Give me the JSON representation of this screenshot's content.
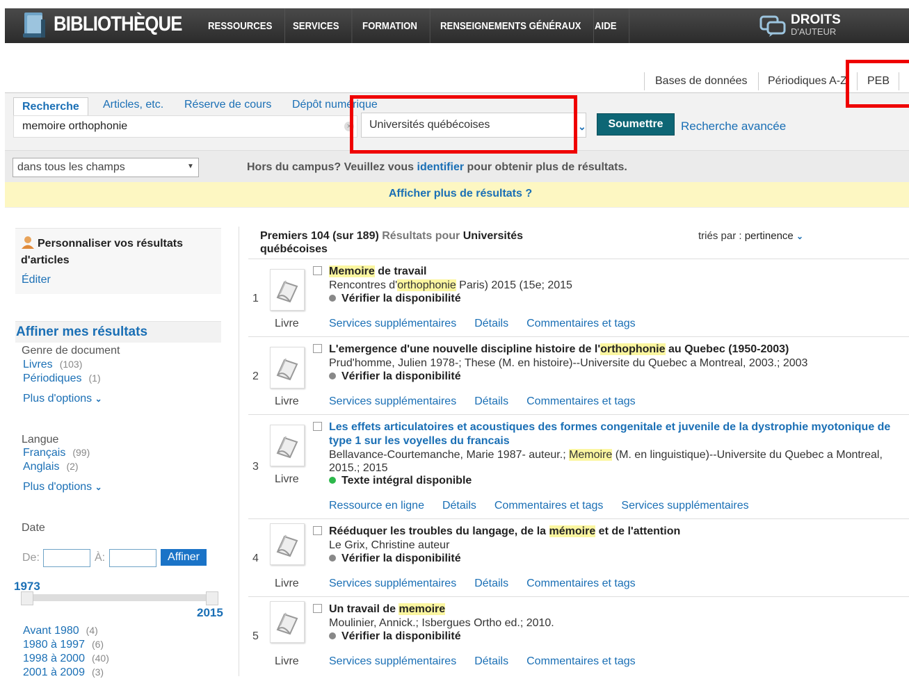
{
  "header": {
    "logo": "BIBLIOTHÈQUE",
    "nav": [
      "RESSOURCES",
      "SERVICES",
      "FORMATION",
      "RENSEIGNEMENTS GÉNÉRAUX",
      "AIDE"
    ],
    "droits_line1": "DROITS",
    "droits_line2": "D'AUTEUR"
  },
  "util_links": [
    "Bases de données",
    "Périodiques A-Z",
    "PEB"
  ],
  "search": {
    "tabs": [
      "Recherche",
      "Articles, etc.",
      "Réserve de cours",
      "Dépôt numérique"
    ],
    "active_tab": "Recherche",
    "query": "memoire orthophonie",
    "scope": "Universités québécoises",
    "submit_label": "Soumettre",
    "advanced_label": "Recherche avancée",
    "field_select": "dans tous les champs",
    "offcampus_pre": "Hors du campus? Veuillez vous",
    "offcampus_link": "identifier",
    "offcampus_post": "pour obtenir plus de résultats.",
    "more_results": "Afficher plus de résultats ?"
  },
  "sidebar": {
    "personalize_title": "Personnaliser vos résultats d'articles",
    "edit_label": "Éditer",
    "refine_title": "Affiner mes résultats",
    "genre_title": "Genre de document",
    "genre_items": [
      {
        "label": "Livres",
        "count": "(103)"
      },
      {
        "label": "Périodiques",
        "count": "(1)"
      }
    ],
    "more_options": "Plus d'options",
    "langue_title": "Langue",
    "langue_items": [
      {
        "label": "Français",
        "count": "(99)"
      },
      {
        "label": "Anglais",
        "count": "(2)"
      }
    ],
    "date_title": "Date",
    "from_label": "De:",
    "to_label": "À:",
    "refine_btn": "Affiner",
    "range_min": "1973",
    "range_max": "2015",
    "date_items": [
      {
        "label": "Avant 1980",
        "count": "(4)"
      },
      {
        "label": "1980 à 1997",
        "count": "(6)"
      },
      {
        "label": "1998 à 2000",
        "count": "(40)"
      },
      {
        "label": "2001 à 2009",
        "count": "(3)"
      }
    ]
  },
  "results_header": {
    "prefix": "Premiers 104 (sur",
    "total": "189)",
    "results_word": "Résultats",
    "pour": "pour",
    "scope_line1": "Universités",
    "scope_line2": "québécoises",
    "sort_label": "triés par :",
    "sort_value": "pertinence"
  },
  "results": [
    {
      "num": "1",
      "type": "Livre",
      "title_parts": [
        [
          "Memoire",
          true
        ],
        [
          " de travail",
          false
        ]
      ],
      "meta_parts": [
        [
          "Rencontres d'",
          false
        ],
        [
          "orthophonie",
          true
        ],
        [
          " Paris) 2015 (15e; 2015",
          false
        ]
      ],
      "availability": "Vérifier la disponibilité",
      "avail_color": "#888888",
      "links": [
        "Services supplémentaires",
        "Détails",
        "Commentaires et tags"
      ]
    },
    {
      "num": "2",
      "type": "Livre",
      "title_parts": [
        [
          "L'emergence d'une nouvelle discipline histoire de l'",
          false
        ],
        [
          "orthophonie",
          true
        ],
        [
          " au Quebec (1950-2003)",
          false
        ]
      ],
      "meta_parts": [
        [
          "Prud'homme, Julien 1978-; These (M. en histoire)--Universite du Quebec a Montreal, 2003.; 2003",
          false
        ]
      ],
      "availability": "Vérifier la disponibilité",
      "avail_color": "#888888",
      "links": [
        "Services supplémentaires",
        "Détails",
        "Commentaires et tags"
      ]
    },
    {
      "num": "3",
      "type": "Livre",
      "title_parts": [
        [
          "Les effets articulatoires et acoustiques des formes congenitale et juvenile de la dystrophie myotonique de type 1 sur les voyelles du francais",
          false
        ]
      ],
      "meta_parts": [
        [
          "Bellavance-Courtemanche, Marie 1987- auteur.; ",
          false
        ],
        [
          "Memoire",
          true
        ],
        [
          " (M. en linguistique)--Universite du Quebec a Montreal, 2015.; 2015",
          false
        ]
      ],
      "availability": "Texte intégral disponible",
      "avail_color": "#2db84b",
      "links": [
        "Ressource en ligne",
        "Détails",
        "Commentaires et tags",
        "Services supplémentaires"
      ]
    },
    {
      "num": "4",
      "type": "Livre",
      "title_parts": [
        [
          "Rééduquer les troubles du langage, de la ",
          false
        ],
        [
          "mémoire",
          true
        ],
        [
          " et de l'attention",
          false
        ]
      ],
      "meta_parts": [
        [
          "Le Grix, Christine auteur",
          false
        ]
      ],
      "availability": "Vérifier la disponibilité",
      "avail_color": "#888888",
      "links": [
        "Services supplémentaires",
        "Détails",
        "Commentaires et tags"
      ]
    },
    {
      "num": "5",
      "type": "Livre",
      "title_parts": [
        [
          "Un travail de ",
          false
        ],
        [
          "memoire",
          true
        ]
      ],
      "meta_parts": [
        [
          "Moulinier, Annick.; Isbergues Ortho ed.; 2010.",
          false
        ]
      ],
      "availability": "Vérifier la disponibilité",
      "avail_color": "#888888",
      "links": [
        "Services supplémentaires",
        "Détails",
        "Commentaires et tags"
      ]
    }
  ],
  "colors": {
    "annotation_red": "#ef0000",
    "submit_bg": "#0e6675",
    "link_blue": "#1a6fb5",
    "highlight": "#fbf6a0",
    "banner_yellow": "#fdf7c2"
  }
}
